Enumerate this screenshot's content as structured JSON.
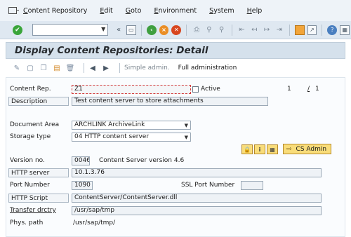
{
  "menubar": {
    "items": [
      "Content Repository",
      "Edit",
      "Goto",
      "Environment",
      "System",
      "Help"
    ]
  },
  "toolbar": {
    "command_field_value": ""
  },
  "title": "Display Content Repositories: Detail",
  "app_toolbar": {
    "simple_admin": "Simple admin.",
    "full_admin": "Full administration"
  },
  "form": {
    "content_rep_label": "Content Rep.",
    "content_rep_value": "Z1",
    "active_label": "Active",
    "paging_current": "1",
    "paging_sep": "/",
    "paging_total": "1",
    "description_label": "Description",
    "description_value": "Test content server to store attachments",
    "document_area_label": "Document Area",
    "document_area_value": "ARCHLINK ArchiveLink",
    "storage_type_label": "Storage type",
    "storage_type_value": "04 HTTP content server",
    "cs_admin_label": "CS Admin",
    "version_label": "Version no.",
    "version_value": "0046",
    "version_desc": "Content Server version 4.6",
    "http_server_label": "HTTP server",
    "http_server_value": "10.1.3.76",
    "port_label": "Port Number",
    "port_value": "1090",
    "ssl_port_label": "SSL Port Number",
    "ssl_port_value": "",
    "http_script_label": "HTTP Script",
    "http_script_value": "ContentServer/ContentServer.dll",
    "transfer_label": "Transfer drctry",
    "transfer_value": "/usr/sap/tmp",
    "phys_label": "Phys. path",
    "phys_value": "/usr/sap/tmp/"
  }
}
